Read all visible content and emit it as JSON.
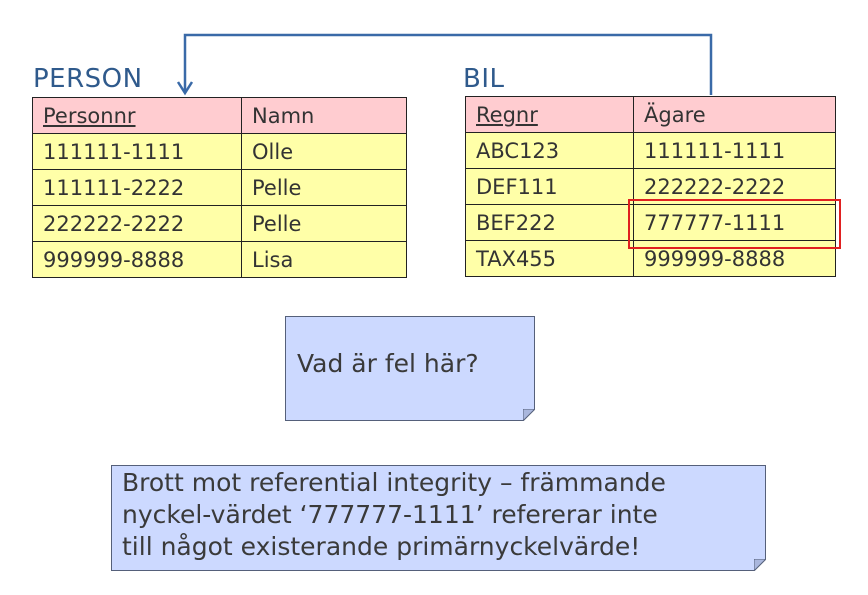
{
  "person_table": {
    "title": "PERSON",
    "columns": [
      "Personnr",
      "Namn"
    ],
    "rows": [
      [
        "111111-1111",
        "Olle"
      ],
      [
        "111111-2222",
        "Pelle"
      ],
      [
        "222222-2222",
        "Pelle"
      ],
      [
        "999999-8888",
        "Lisa"
      ]
    ]
  },
  "bil_table": {
    "title": "BIL",
    "columns": [
      "Regnr",
      "Ägare"
    ],
    "rows": [
      [
        "ABC123",
        "111111-1111"
      ],
      [
        "DEF111",
        "222222-2222"
      ],
      [
        "BEF222",
        "777777-1111"
      ],
      [
        "TAX455",
        "999999-8888"
      ]
    ]
  },
  "question_note": {
    "text": "Vad är fel här?"
  },
  "answer_note": {
    "lines": [
      "Brott mot referential integrity – främmande",
      "nyckel-värdet ‘777777-1111’ refererar inte",
      "till något existerande primärnyckelvärde!"
    ]
  },
  "colors": {
    "title": "#2f5a8c",
    "header_fill": "#ffccd0",
    "cell_fill": "#ffffa8",
    "note_fill": "#ccd9ff",
    "arrow": "#3a6aa8",
    "highlight": "#e02020"
  },
  "icons": {
    "reference_arrow": "arrow-down-icon"
  }
}
